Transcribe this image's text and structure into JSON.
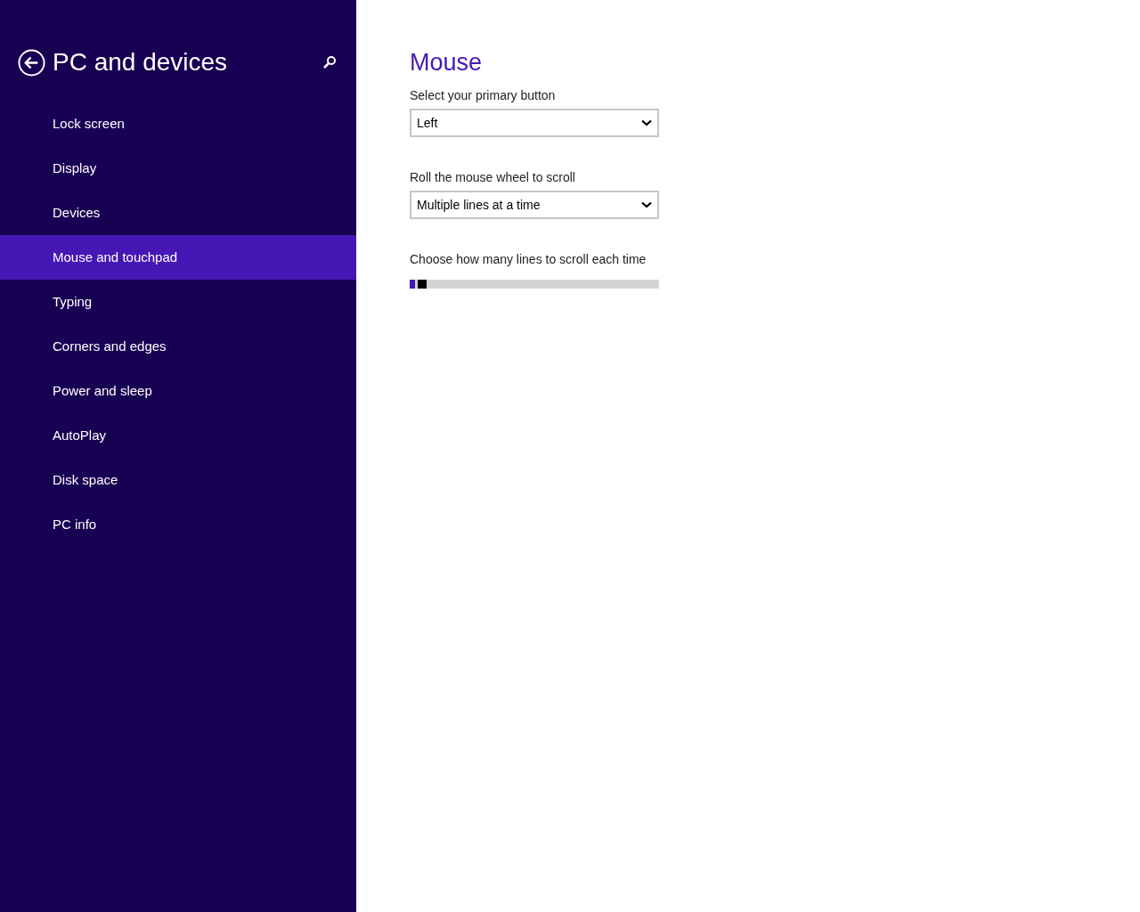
{
  "sidebar": {
    "title": "PC and devices",
    "items": [
      {
        "label": "Lock screen",
        "selected": false
      },
      {
        "label": "Display",
        "selected": false
      },
      {
        "label": "Devices",
        "selected": false
      },
      {
        "label": "Mouse and touchpad",
        "selected": true
      },
      {
        "label": "Typing",
        "selected": false
      },
      {
        "label": "Corners and edges",
        "selected": false
      },
      {
        "label": "Power and sleep",
        "selected": false
      },
      {
        "label": "AutoPlay",
        "selected": false
      },
      {
        "label": "Disk space",
        "selected": false
      },
      {
        "label": "PC info",
        "selected": false
      }
    ]
  },
  "main": {
    "heading": "Mouse",
    "settings": [
      {
        "kind": "dropdown",
        "label": "Select your primary button",
        "value": "Left"
      },
      {
        "kind": "dropdown",
        "label": "Roll the mouse wheel to scroll",
        "value": "Multiple lines at a time"
      },
      {
        "kind": "slider",
        "label": "Choose how many lines to scroll each time",
        "level": 0.02
      }
    ]
  }
}
